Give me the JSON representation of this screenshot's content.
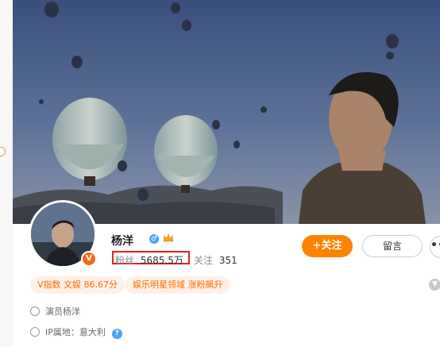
{
  "profile": {
    "name": "杨洋",
    "verified_badge": "V",
    "gender_icon": "male-icon",
    "fans_label": "粉丝",
    "fans_count": "5685.5万",
    "following_label": "关注",
    "following_count": "351"
  },
  "actions": {
    "follow_label": "+关注",
    "message_label": "留言",
    "more_label": "•••"
  },
  "tags": [
    "V指数 文娱 86.67分",
    "娱乐明星领域 涨粉飙升"
  ],
  "info": {
    "bio": "演员杨洋",
    "ip_location": "IP属地：意大利",
    "help_symbol": "?"
  },
  "colors": {
    "accent": "#ff8200",
    "verified": "#f26b1d",
    "highlight_box": "#e0221a",
    "link_blue": "#4aa3f0"
  }
}
